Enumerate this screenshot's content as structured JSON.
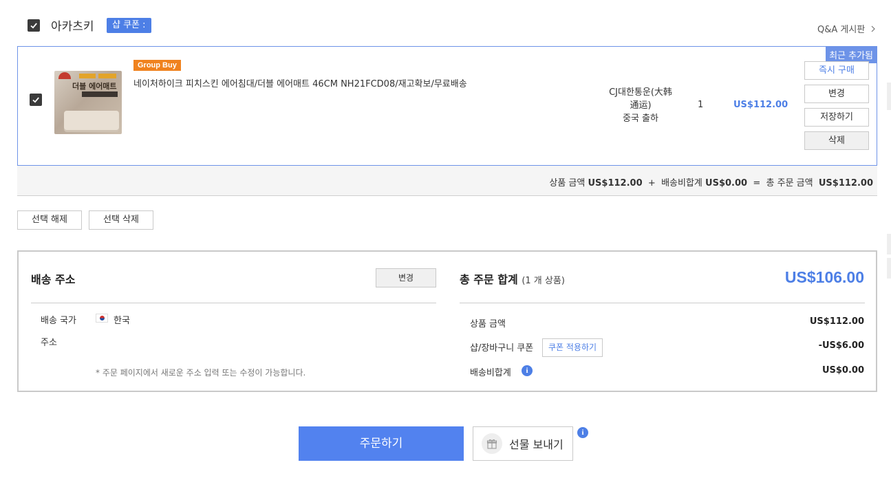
{
  "store": {
    "name": "아카츠키",
    "coupon_label": "샵 쿠폰 :",
    "qa_link": "Q&A 게시판"
  },
  "item": {
    "recent_badge": "최근 추가됨",
    "thumb_title": "더블 에어매트",
    "group_buy": "Group Buy",
    "title": "네이처하이크 피치스킨 에어침대/더블 에어매트 46CM NH21FCD08/재고확보/무료배송",
    "shipper_line1": "CJ대한통운(大韩",
    "shipper_line2": "通运)",
    "shipper_line3": "중국 출하",
    "quantity": "1",
    "price": "US$112.00",
    "buttons": {
      "buy_now": "즉시 구매",
      "change": "변경",
      "save": "저장하기",
      "delete": "삭제"
    }
  },
  "summary": {
    "goods_label": "상품 금액",
    "goods_value": "US$112.00",
    "plus": "+",
    "shipping_label": "배송비합계",
    "shipping_value": "US$0.00",
    "equals": "=",
    "total_label": "총 주문 금액",
    "total_value": "US$112.00"
  },
  "selection": {
    "deselect": "선택 해제",
    "delete_selected": "선택 삭제"
  },
  "shipping": {
    "title": "배송 주소",
    "change": "변경",
    "country_label": "배송 국가",
    "country_value": "한국",
    "address_label": "주소",
    "note": "* 주문 페이지에서 새로운 주소 입력 또는 수정이 가능합니다."
  },
  "order_total": {
    "title": "총 주문 합계",
    "subtitle": "(1 개 상품)",
    "amount": "US$106.00",
    "goods_label": "상품 금액",
    "goods_value": "US$112.00",
    "coupon_label": "샵/장바구니 쿠폰",
    "coupon_button": "쿠폰 적용하기",
    "coupon_value": "-US$6.00",
    "shipping_label": "배송비합계",
    "shipping_value": "US$0.00",
    "info_glyph": "i"
  },
  "actions": {
    "order": "주문하기",
    "gift": "선물 보내기",
    "info_glyph": "i"
  },
  "colors": {
    "accent": "#4d7fe6",
    "group_buy": "#f0821e"
  }
}
